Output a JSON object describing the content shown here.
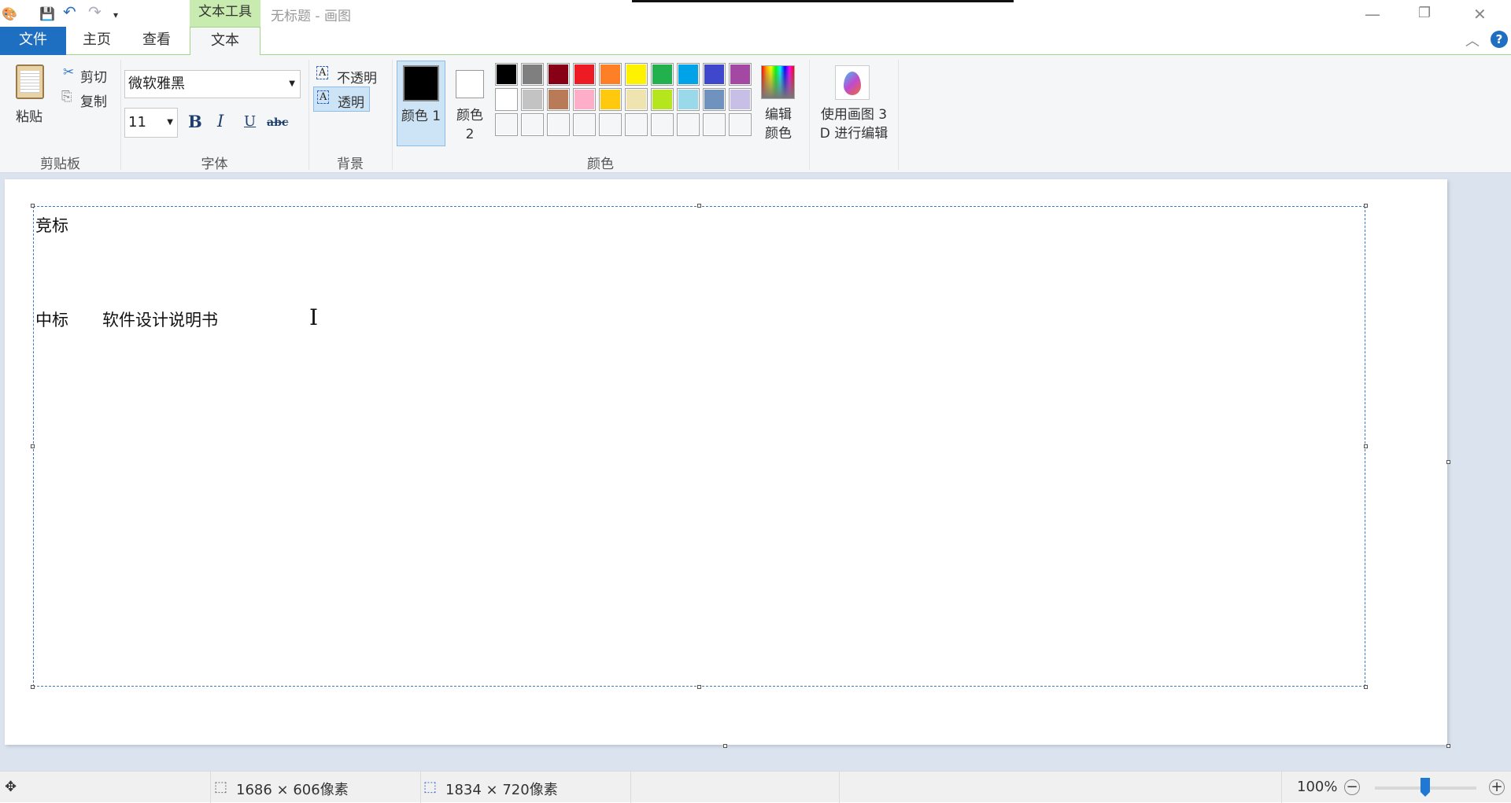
{
  "window": {
    "title": "无标题 - 画图",
    "context_tab_group": "文本工具"
  },
  "tabs": [
    {
      "label": "文件"
    },
    {
      "label": "主页"
    },
    {
      "label": "查看"
    },
    {
      "label": "文本"
    }
  ],
  "ribbon": {
    "clipboard": {
      "paste": "粘贴",
      "cut": "剪切",
      "copy": "复制",
      "group": "剪贴板"
    },
    "font": {
      "family": "微软雅黑",
      "size": "11",
      "bold": "B",
      "italic": "I",
      "underline": "U",
      "strike": "abc",
      "group": "字体"
    },
    "background": {
      "opaque": "不透明",
      "transparent": "透明",
      "group": "背景",
      "selected": "透明"
    },
    "colors": {
      "color1": "颜色 1",
      "color2": "颜色 2",
      "color1_value": "#000000",
      "color2_value": "#ffffff",
      "edit": "编辑颜色",
      "group": "颜色",
      "palette": [
        "#000000",
        "#7f7f7f",
        "#880015",
        "#ed1c24",
        "#ff7f27",
        "#fff200",
        "#22b14c",
        "#00a2e8",
        "#3f48cc",
        "#a349a4",
        "#ffffff",
        "#c3c3c3",
        "#b97a57",
        "#ffaec9",
        "#ffc90e",
        "#efe4b0",
        "#b5e61d",
        "#99d9ea",
        "#7092be",
        "#c8bfe7",
        "#f5f6f7",
        "#f5f6f7",
        "#f5f6f7",
        "#f5f6f7",
        "#f5f6f7",
        "#f5f6f7",
        "#f5f6f7",
        "#f5f6f7",
        "#f5f6f7",
        "#f5f6f7"
      ]
    },
    "paint3d": {
      "label_line1": "使用画图 3",
      "label_line2": "D 进行编辑"
    }
  },
  "canvas": {
    "line1": "竞标",
    "line2a": "中标",
    "line2b": "软件设计说明书"
  },
  "status": {
    "selection_size": "1686 × 606像素",
    "canvas_size": "1834 × 720像素",
    "zoom": "100%",
    "zoom_level_percent": 100
  }
}
